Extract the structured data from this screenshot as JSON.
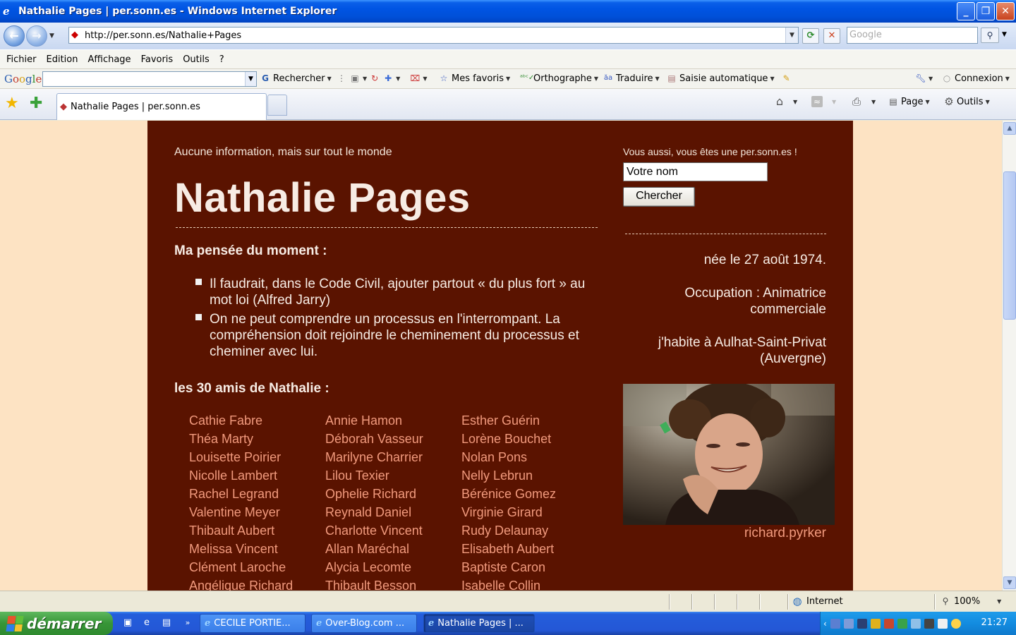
{
  "window": {
    "title": "Nathalie Pages | per.sonn.es - Windows Internet Explorer",
    "minimize_label": "_",
    "maximize_label": "❐",
    "close_label": "✕"
  },
  "address": {
    "url": "http://per.sonn.es/Nathalie+Pages",
    "search_placeholder": "Google"
  },
  "menu": [
    "Fichier",
    "Edition",
    "Affichage",
    "Favoris",
    "Outils",
    "?"
  ],
  "google_toolbar": {
    "logo": "Google",
    "search_label": "Rechercher",
    "favorites_label": "Mes favoris",
    "spell_label": "Orthographe",
    "translate_label": "Traduire",
    "autofill_label": "Saisie automatique",
    "connect_label": "Connexion"
  },
  "tabs": {
    "active_label": "Nathalie Pages | per.sonn.es",
    "page_label": "Page",
    "tools_label": "Outils"
  },
  "page": {
    "tagline": "Aucune information, mais sur tout le monde",
    "name": "Nathalie Pages",
    "thought_heading": "Ma pensée du moment :",
    "thoughts": [
      "Il faudrait, dans le Code Civil, ajouter partout « du plus fort » au mot loi (Alfred Jarry)",
      "On ne peut comprendre un processus en l'interrompant. La compréhension doit rejoindre le cheminement du processus et cheminer avec lui."
    ],
    "friends_heading": "les 30 amis de Nathalie :",
    "friends": [
      "Cathie Fabre",
      "Annie Hamon",
      "Esther Guérin",
      "Théa Marty",
      "Déborah Vasseur",
      "Lorène Bouchet",
      "Louisette Poirier",
      "Marilyne Charrier",
      "Nolan Pons",
      "Nicolle Lambert",
      "Lilou Texier",
      "Nelly Lebrun",
      "Rachel Legrand",
      "Ophelie Richard",
      "Bérénice Gomez",
      "Valentine Meyer",
      "Reynald Daniel",
      "Virginie Girard",
      "Thibault Aubert",
      "Charlotte Vincent",
      "Rudy Delaunay",
      "Melissa Vincent",
      "Allan Maréchal",
      "Elisabeth Aubert",
      "Clément Laroche",
      "Alycia Lecomte",
      "Baptiste Caron",
      "Angélique Richard",
      "Thibault Besson",
      "Isabelle Collin"
    ],
    "side_prompt": "Vous aussi, vous êtes une per.sonn.es !",
    "name_input_value": "Votre nom",
    "search_button": "Chercher",
    "birth": "née le 27 août 1974.",
    "occupation": "Occupation : Animatrice commerciale",
    "residence": "j'habite à Aulhat-Saint-Privat (Auvergne)",
    "photo_credit": "richard.pyrker"
  },
  "status": {
    "zone": "Internet",
    "zoom": "100%"
  },
  "taskbar": {
    "start_label": "démarrer",
    "tasks": [
      "CECILE PORTIE...",
      "Over-Blog.com ...",
      "Nathalie Pages | ..."
    ],
    "clock": "21:27"
  },
  "colors": {
    "page_bg": "#fde3c3",
    "card_bg": "#5a1300",
    "link": "#f19a7d"
  }
}
